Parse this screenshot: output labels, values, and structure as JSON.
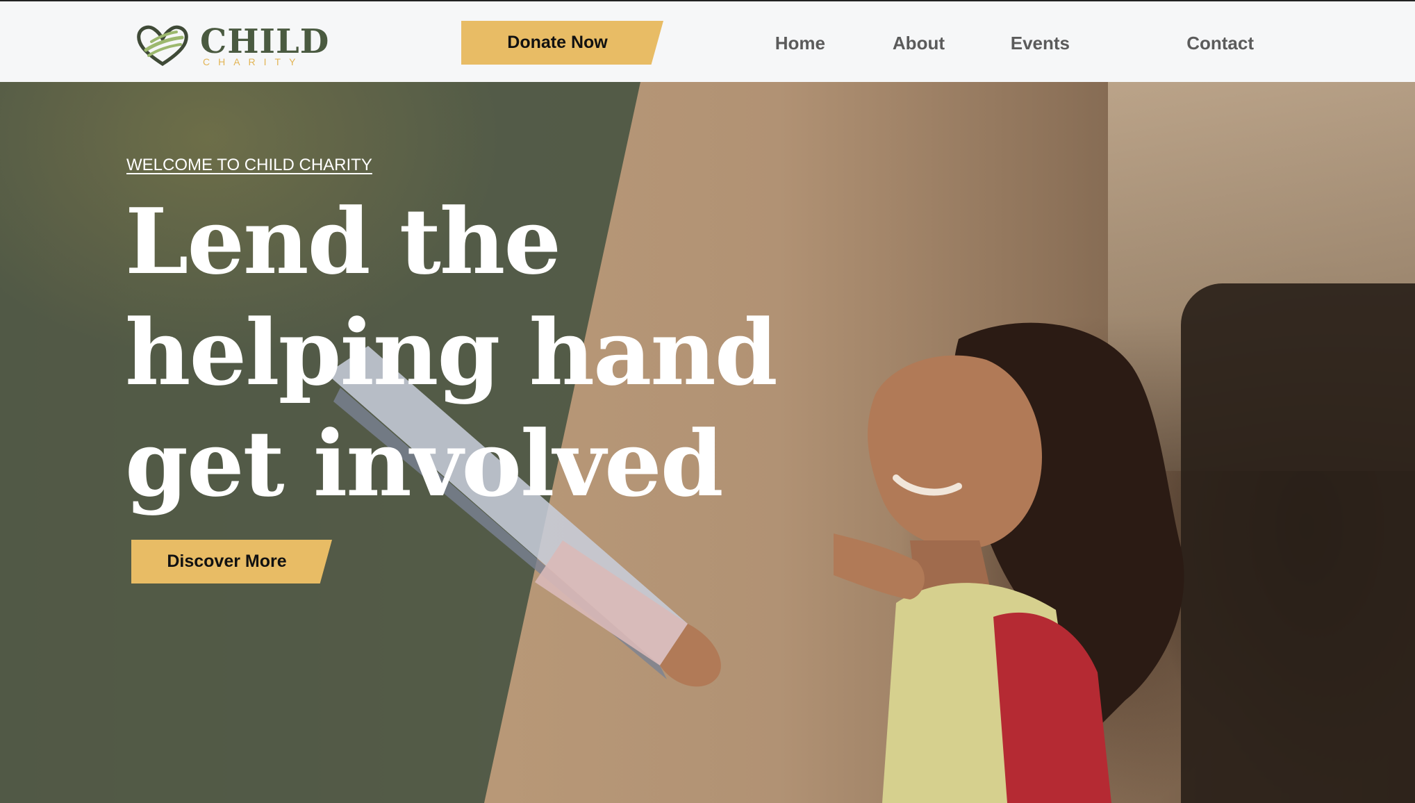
{
  "header": {
    "logo": {
      "title": "CHILD",
      "subtitle": "CHARITY"
    },
    "donate_label": "Donate Now",
    "nav": [
      {
        "label": "Home"
      },
      {
        "label": "About"
      },
      {
        "label": "Events"
      },
      {
        "label": "Contact"
      }
    ]
  },
  "hero": {
    "welcome": "WELCOME TO CHILD CHARITY",
    "headline": [
      "Lend the",
      "helping hand",
      "get involved"
    ],
    "cta_label": "Discover More"
  },
  "colors": {
    "accent": "#e8bc65",
    "overlay": "#485442",
    "logo_text": "#4a5a40",
    "logo_sub": "#e2b556",
    "nav_text": "#5b5b5b"
  }
}
